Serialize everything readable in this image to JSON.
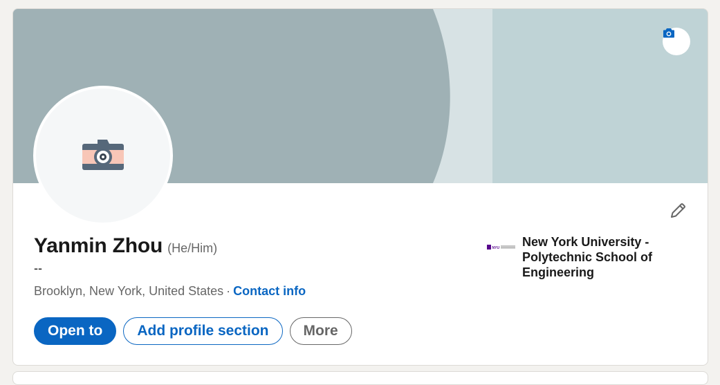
{
  "profile": {
    "name": "Yanmin Zhou",
    "pronouns": "(He/Him)",
    "headline": "--",
    "location": "Brooklyn, New York, United States",
    "separator": "·",
    "contact_info_label": "Contact info"
  },
  "actions": {
    "open_to_label": "Open to",
    "add_section_label": "Add profile section",
    "more_label": "More"
  },
  "education": {
    "school_name": "New York University - Polytechnic School of Engineering",
    "logo_text": "NYU"
  },
  "icons": {
    "banner_camera": "camera-icon",
    "avatar_placeholder": "camera-icon",
    "edit": "pencil-icon"
  },
  "colors": {
    "accent": "#0a66c2",
    "banner_dark": "#9fb1b5",
    "banner_light": "#bfd3d6",
    "banner_stripe": "#d7e2e4",
    "nyu_purple": "#57068c"
  }
}
